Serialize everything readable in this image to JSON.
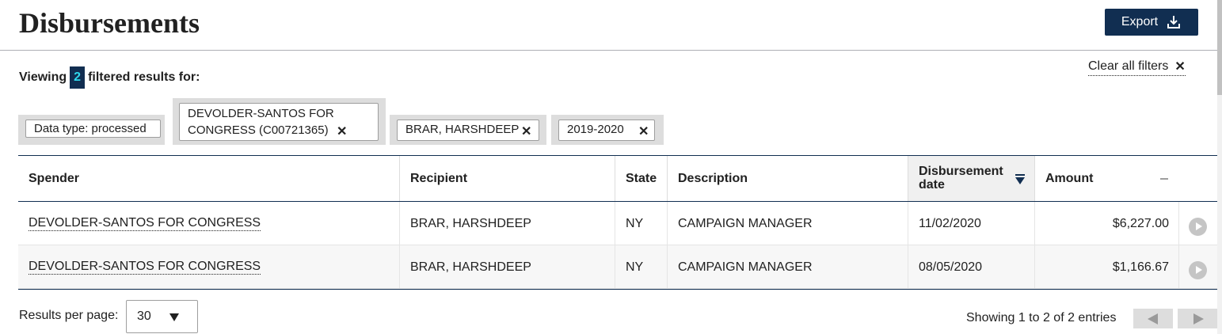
{
  "header": {
    "title": "Disbursements",
    "export_label": "Export"
  },
  "filters": {
    "viewing_prefix": "Viewing",
    "count": "2",
    "viewing_suffix": "filtered results for:",
    "clear_all_label": "Clear all filters",
    "tags": [
      {
        "label": "Data type: processed",
        "removable": false
      },
      {
        "label_line1": "DEVOLDER-SANTOS FOR",
        "label_line2": "CONGRESS (C00721365)",
        "removable": true
      },
      {
        "label": "BRAR, HARSHDEEP",
        "removable": true
      },
      {
        "label": "2019-2020",
        "removable": true
      }
    ]
  },
  "table": {
    "columns": {
      "spender": "Spender",
      "recipient": "Recipient",
      "state": "State",
      "description": "Description",
      "date_line1": "Disbursement",
      "date_line2": "date",
      "amount": "Amount"
    },
    "sorted_column": "Disbursement date",
    "sort_direction": "descending",
    "rows": [
      {
        "spender": "DEVOLDER-SANTOS FOR CONGRESS",
        "recipient": "BRAR, HARSHDEEP",
        "state": "NY",
        "description": "CAMPAIGN MANAGER",
        "date": "11/02/2020",
        "amount": "$6,227.00"
      },
      {
        "spender": "DEVOLDER-SANTOS FOR CONGRESS",
        "recipient": "BRAR, HARSHDEEP",
        "state": "NY",
        "description": "CAMPAIGN MANAGER",
        "date": "08/05/2020",
        "amount": "$1,166.67"
      }
    ]
  },
  "footer": {
    "results_per_page_label": "Results per page:",
    "results_per_page_value": "30",
    "showing_text": "Showing 1 to 2 of 2 entries"
  },
  "colors": {
    "primary_navy": "#112e51",
    "count_text": "#2fd9ec",
    "tag_background": "#dddddd"
  },
  "icons": {
    "export": "download-icon",
    "clear": "close-icon",
    "tag_remove": "close-icon",
    "sort": "sort-descending-icon",
    "row_expand": "play-circle-icon",
    "select_caret": "caret-down-icon",
    "prev": "arrow-left-icon",
    "next": "arrow-right-icon"
  }
}
